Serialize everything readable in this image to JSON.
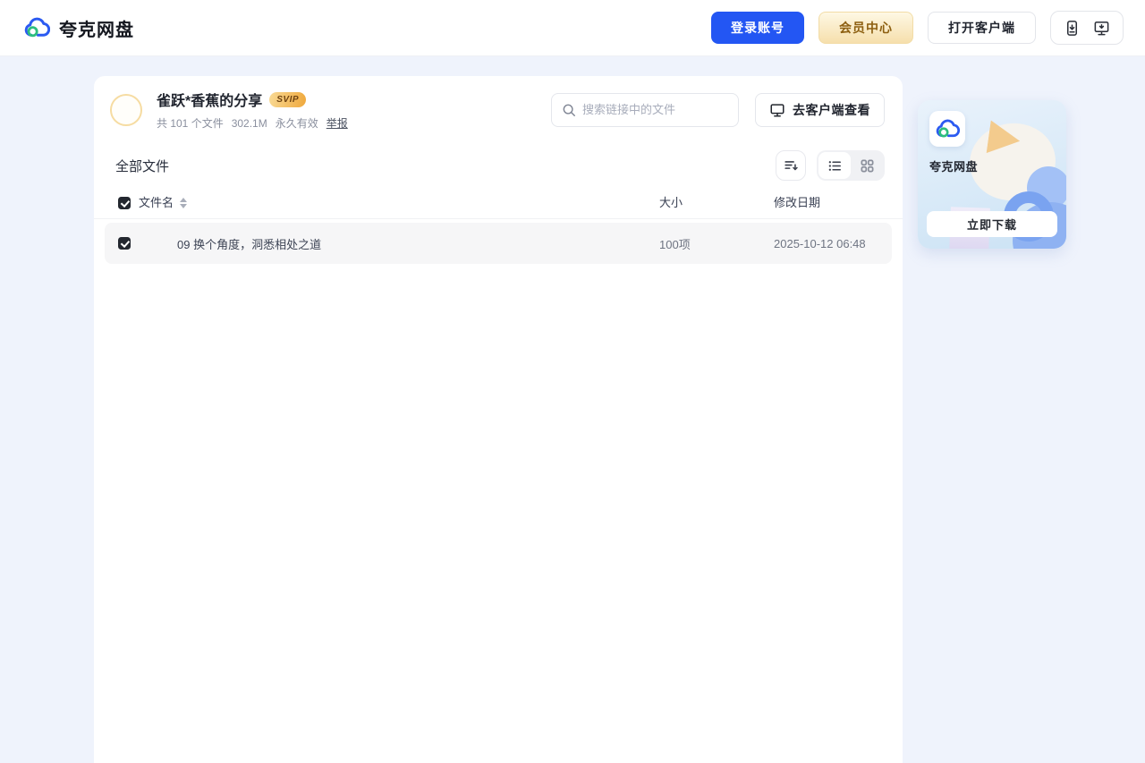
{
  "header": {
    "brand": "夸克网盘",
    "login_label": "登录账号",
    "member_label": "会员中心",
    "open_client_label": "打开客户端"
  },
  "share": {
    "title": "雀跃*香蕉的分享",
    "badge": "SVIP",
    "files_count": "共 101 个文件",
    "total_size": "302.1M",
    "validity": "永久有效",
    "report_label": "举报",
    "search_placeholder": "搜索链接中的文件",
    "client_view_label": "去客户端查看"
  },
  "files": {
    "section_title": "全部文件",
    "columns": {
      "name": "文件名",
      "size": "大小",
      "modified": "修改日期"
    },
    "rows": [
      {
        "name": "09 换个角度，洞悉相处之道",
        "size": "100项",
        "modified": "2025-10-12 06:48",
        "checked": true
      }
    ],
    "select_all_checked": true,
    "view_mode": "list"
  },
  "promo": {
    "app_name": "夸克网盘",
    "download_label": "立即下载"
  },
  "colors": {
    "accent_blue": "#2356F3",
    "logo_blue": "#2B5AF1",
    "logo_green": "#2EBE7E",
    "member_gold_text": "#8D5F10",
    "badge_gold": "#EFA83C",
    "page_bg": "#EFF3FC",
    "row_bg": "#F6F6F7"
  }
}
